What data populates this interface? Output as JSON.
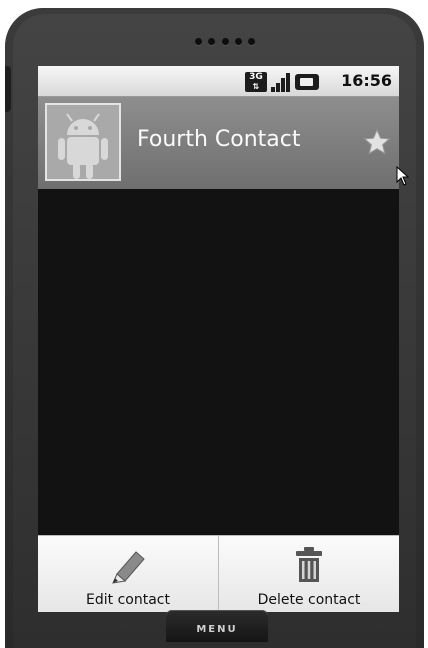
{
  "status_bar": {
    "network_badge": "3G",
    "time": "16:56",
    "icons": [
      "network-3g-icon",
      "signal-icon",
      "battery-icon"
    ]
  },
  "contact": {
    "name": "Fourth Contact",
    "starred": true
  },
  "menu": {
    "options": [
      {
        "label": "Edit contact",
        "icon": "pencil-icon"
      },
      {
        "label": "Delete contact",
        "icon": "trash-icon"
      }
    ]
  },
  "device": {
    "menu_key_label": "MENU"
  }
}
